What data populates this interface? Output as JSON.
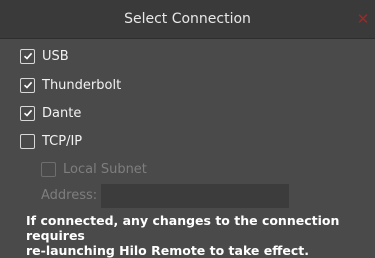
{
  "dialog": {
    "title": "Select Connection",
    "close_icon": "close-icon",
    "accent_color": "#9a2a2a"
  },
  "options": [
    {
      "label": "USB",
      "checked": true
    },
    {
      "label": "Thunderbolt",
      "checked": true
    },
    {
      "label": "Dante",
      "checked": true
    },
    {
      "label": "TCP/IP",
      "checked": false
    }
  ],
  "tcp": {
    "local_subnet_label": "Local Subnet",
    "local_subnet_checked": false,
    "address_label": "Address:",
    "address_value": ""
  },
  "note": "If connected, any changes to the connection requires\nre-launching Hilo Remote to take effect."
}
